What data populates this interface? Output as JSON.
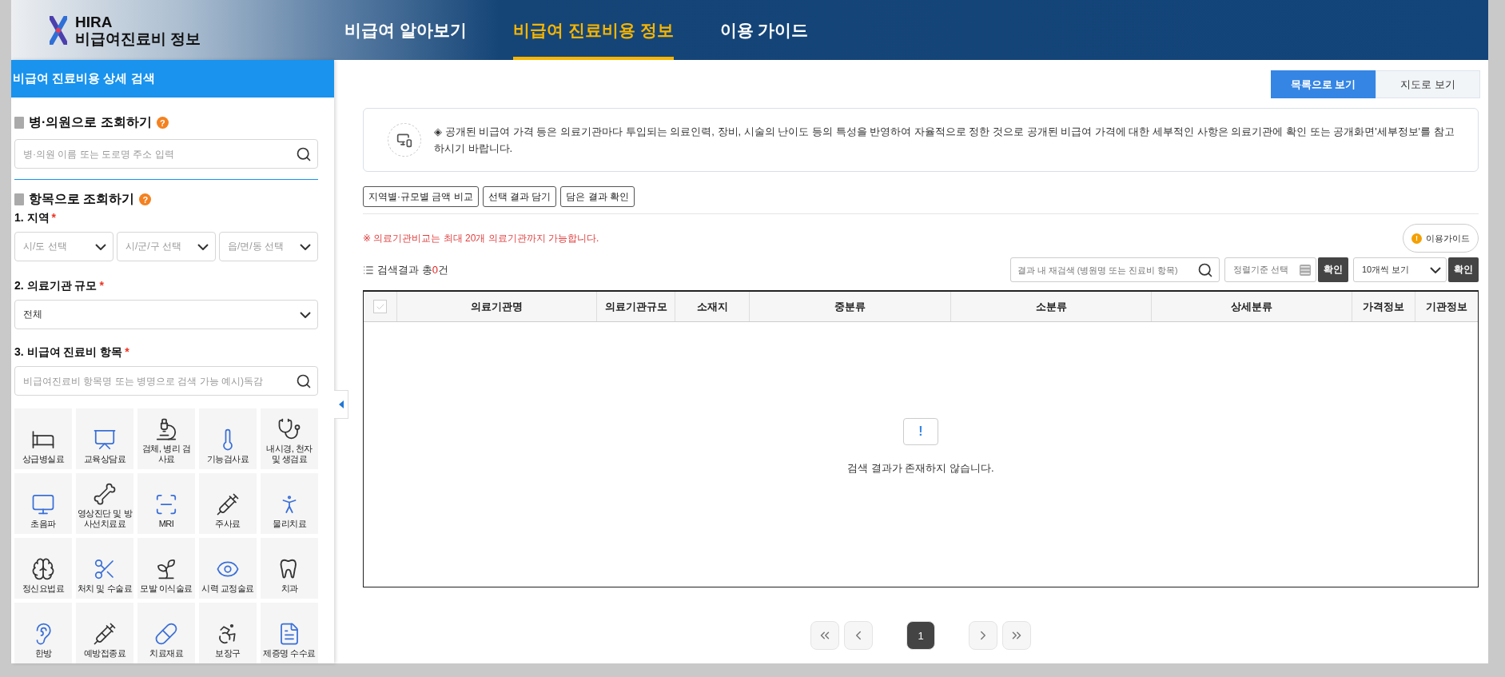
{
  "header": {
    "logo": {
      "line1": "HIRA",
      "line2": "비급여진료비 정보"
    },
    "nav": [
      {
        "label": "비급여 알아보기",
        "selected": false
      },
      {
        "label": "비급여 진료비용 정보",
        "selected": true
      },
      {
        "label": "이용 가이드",
        "selected": false
      }
    ]
  },
  "sidebar": {
    "title": "비급여 진료비용 상세 검색",
    "hospital_search": {
      "title": "병·의원으로 조회하기",
      "help": "?",
      "placeholder": "병·의원 이름 또는 도로명 주소 입력"
    },
    "item_search": {
      "title": "항목으로 조회하기",
      "help": "?",
      "region": {
        "label": "1. 지역",
        "required_mark": "*",
        "selects": [
          "시/도 선택",
          "시/군/구 선택",
          "읍/면/동 선택"
        ]
      },
      "scale": {
        "label": "2. 의료기관 규모",
        "required_mark": "*",
        "value": "전체"
      },
      "item": {
        "label": "3. 비급여 진료비 항목",
        "required_mark": "*",
        "placeholder": "비급여진료비 항목명 또는 병명으로 검색 가능 예시)독감"
      }
    },
    "categories": [
      {
        "label": "상급병실료"
      },
      {
        "label": "교육상담료"
      },
      {
        "label": "검체, 병리 검사료"
      },
      {
        "label": "기능검사료"
      },
      {
        "label": "내시경, 천자 및 생검료"
      },
      {
        "label": "초음파"
      },
      {
        "label": "영상진단 및 방사선치료료"
      },
      {
        "label": "MRI"
      },
      {
        "label": "주사료"
      },
      {
        "label": "물리치료"
      },
      {
        "label": "정신요법료"
      },
      {
        "label": "처치 및 수술료"
      },
      {
        "label": "모발 이식술료"
      },
      {
        "label": "시력 교정술료"
      },
      {
        "label": "치과"
      },
      {
        "label": "한방"
      },
      {
        "label": "예방접종료"
      },
      {
        "label": "치료재료"
      },
      {
        "label": "보장구"
      },
      {
        "label": "제증명 수수료"
      }
    ]
  },
  "main": {
    "view_toggle": [
      {
        "label": "목록으로 보기",
        "selected": true
      },
      {
        "label": "지도로 보기",
        "selected": false
      }
    ],
    "notice": "◈ 공개된 비급여 가격 등은 의료기관마다 투입되는 의료인력, 장비, 시술의 난이도 등의 특성을 반영하여 자율적으로 정한 것으로 공개된 비급여 가격에 대한 세부적인 사항은 의료기관에 확인 또는 공개화면'세부정보'를 참고하시기 바랍니다.",
    "actions": [
      "지역별·규모별 금액 비교",
      "선택 결과 담기",
      "담은 결과 확인"
    ],
    "limit_notice": "※ 의료기관비교는 최대 20개 의료기관까지 가능합니다.",
    "guide_button": {
      "icon": "!",
      "label": "이용가이드"
    },
    "result": {
      "prefix": "검색결과 총",
      "count": "0",
      "suffix": "건"
    },
    "re_search": {
      "placeholder": "결과 내 재검색 (병원명 또는 진료비 항목)"
    },
    "sort": {
      "placeholder": "정렬기준 선택"
    },
    "sort_confirm": "확인",
    "page_size": {
      "value": "10개씩 보기"
    },
    "page_size_confirm": "확인",
    "table": {
      "select_all": {
        "checked": false
      },
      "columns": [
        "의료기관명",
        "의료기관규모",
        "소재지",
        "중분류",
        "소분류",
        "상세분류",
        "가격정보",
        "기관정보"
      ],
      "empty": {
        "icon": "!",
        "message": "검색 결과가 존재하지 않습니다."
      }
    },
    "pagination": {
      "pages": [
        {
          "label": "1",
          "selected": true
        }
      ]
    }
  }
}
